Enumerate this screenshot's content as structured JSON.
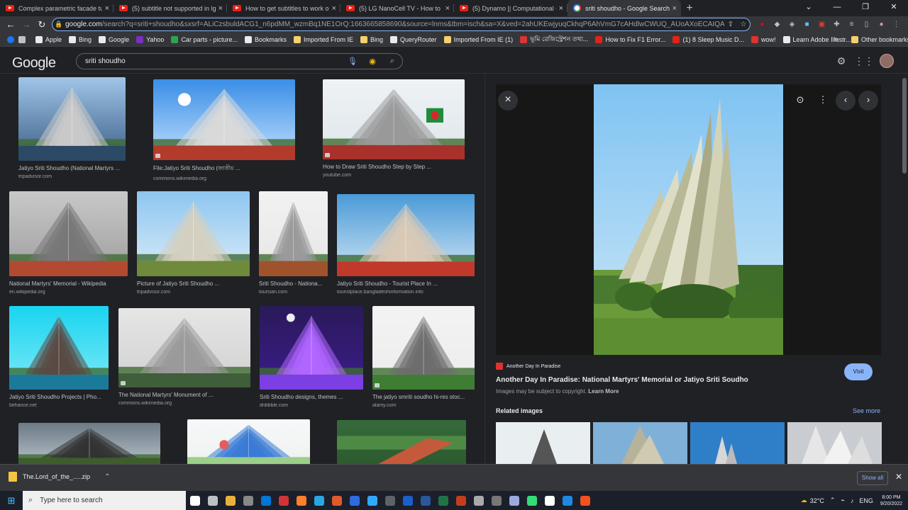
{
  "tabs": [
    {
      "label": "Complex parametric facade tuto",
      "type": "yt"
    },
    {
      "label": "(5) subtitle not supported in lg tv",
      "type": "yt"
    },
    {
      "label": "How to get subtitles to work on",
      "type": "yt"
    },
    {
      "label": "(5) LG NanoCell TV - How to Ena",
      "type": "yt"
    },
    {
      "label": "(5) Dynamo || Computational Ge",
      "type": "yt"
    },
    {
      "label": "sriti shoudho - Google Search",
      "type": "g",
      "active": true
    }
  ],
  "browser": {
    "url_domain": "google.com",
    "url_rest": "/search?q=sriti+shoudho&sxsrf=ALiCzsbuldACG1_n6pdMM_wzmBq1NE1OrQ:1663665858690&source=lnms&tbm=isch&sa=X&ved=2ahUKEwjyuqCkhqP6AhVmG7cAHdlwCWUQ_AUoAXoECAIQAw&biw=1920&b",
    "new_tab": "+",
    "win_min": "⌄",
    "win_controls": [
      "—",
      "❐",
      "✕"
    ]
  },
  "bookmarks": [
    {
      "label": "Apple",
      "color": "#e8eaed"
    },
    {
      "label": "Bing",
      "color": "#e8eaed"
    },
    {
      "label": "Google",
      "color": "#e8eaed"
    },
    {
      "label": "Yahoo",
      "color": "#7b2fbe"
    },
    {
      "label": "Car parts - picture...",
      "color": "#2ea44f"
    },
    {
      "label": "Bookmarks",
      "color": "#e8eaed"
    },
    {
      "label": "Imported From IE",
      "color": "#f4d06f"
    },
    {
      "label": "Bing",
      "color": "#f4d06f"
    },
    {
      "label": "QueryRouter",
      "color": "#e8eaed"
    },
    {
      "label": "Imported From IE (1)",
      "color": "#f4d06f"
    },
    {
      "label": "ভূমি রেজিস্ট্রেশন তথ্য...",
      "color": "#d33"
    },
    {
      "label": "How to Fix F1 Error...",
      "color": "#e62117"
    },
    {
      "label": "(1) 8 Sleep Music D...",
      "color": "#e62117"
    },
    {
      "label": "wow!",
      "color": "#d33"
    },
    {
      "label": "Learn Adobe Illustr...",
      "color": "#e8eaed"
    }
  ],
  "bookmarks_more": "»",
  "other_bookmarks": "Other bookmarks",
  "google": {
    "logo": "Google",
    "query": "sriti shoudho"
  },
  "results": [
    {
      "caption": "Jatiyo Sriti Shoudho (National Martyrs ...",
      "source": "tripadvisor.com",
      "scene": "day"
    },
    {
      "caption": "File:Jatiyo Sriti Shoudho (জাতীয় ...",
      "source": "commons.wikimedia.org",
      "scene": "sky",
      "badge": true
    },
    {
      "caption": "How to Draw Sriti Shoudho Step by Step ...",
      "source": "youtube.com",
      "scene": "draw",
      "badge": true
    },
    {
      "caption": "National Martyrs' Memorial - Wikipedia",
      "source": "en.wikipedia.org",
      "scene": "plaza"
    },
    {
      "caption": "Picture of Jatiyo Sriti Shoudho ...",
      "source": "tripadvisor.com",
      "scene": "side"
    },
    {
      "caption": "Sriti Shoudho - Nationa...",
      "source": "toursian.com",
      "scene": "white"
    },
    {
      "caption": "Jatiyo Sriti Shoudho - Tourist Place In ...",
      "source": "touristplace.bangladeshinformation.info",
      "scene": "flowers"
    },
    {
      "caption": "Jatiyo Sriti Shoudho Projects | Pho...",
      "source": "behance.net",
      "scene": "cyan"
    },
    {
      "caption": "The National Martyrs' Monument of ...",
      "source": "commons.wikimedia.org",
      "scene": "haze",
      "badge": true
    },
    {
      "caption": "Sriti Shoudho designs, themes ...",
      "source": "dribbble.com",
      "scene": "night"
    },
    {
      "caption": "The jatiyo smriti soudho hi-res stoc...",
      "source": "alamy.com",
      "scene": "dusk",
      "badge": true
    },
    {
      "caption": "",
      "source": "",
      "scene": "cloud"
    },
    {
      "caption": "",
      "source": "",
      "scene": "art"
    },
    {
      "caption": "",
      "source": "",
      "scene": "aerial"
    }
  ],
  "preview": {
    "source": "Another Day In Paradise",
    "title": "Another Day In Paradise: National Martyrs' Memorial or Jatiyo Sriti Soudho",
    "copyright": "Images may be subject to copyright.",
    "learn_more": "Learn More",
    "visit": "Visit",
    "related": "Related images",
    "see_more": "See more"
  },
  "download": {
    "file": "The.Lord_of_the_.....zip",
    "show_all": "Show all"
  },
  "taskbar": {
    "search_placeholder": "Type here to search",
    "temp": "32°C",
    "lang": "ENG",
    "time": "8:00 PM",
    "date": "9/20/2022"
  },
  "colors": {
    "accent": "#8ab4f8",
    "bg": "#202124"
  }
}
